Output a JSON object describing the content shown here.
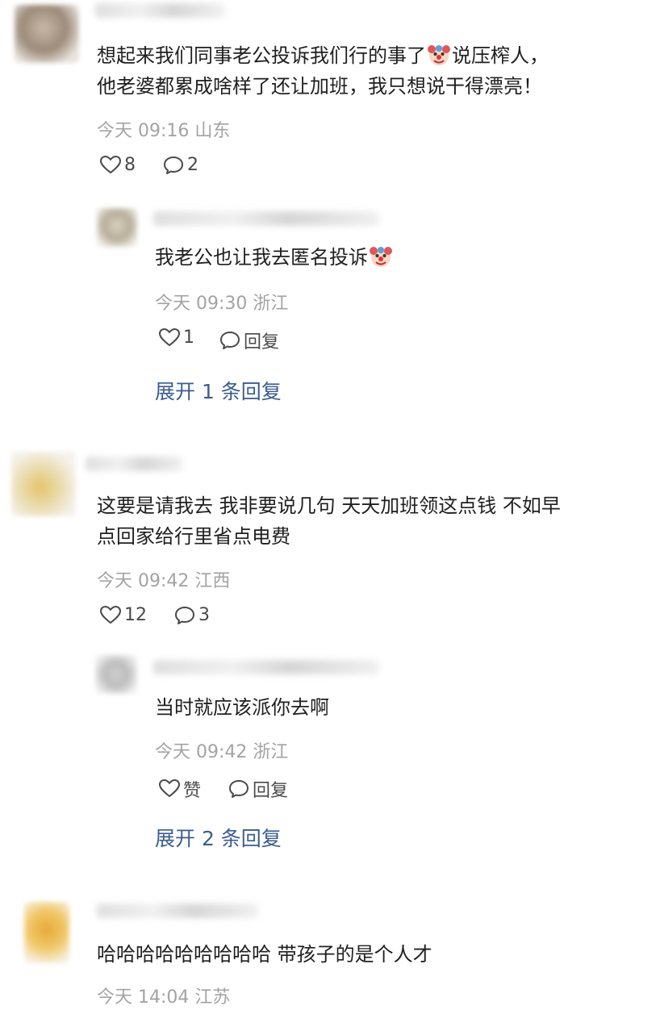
{
  "comments": [
    {
      "text_line1": "想起来我们同事老公投诉我们行的事了",
      "emoji": "clown-face-emoji",
      "text_line1_after": "说压榨人，",
      "text_line2": "他老婆都累成啥样了还让加班，我只想说干得漂亮！",
      "meta": "今天 09:16 山东",
      "likes": "8",
      "replies": "2",
      "reply": {
        "text": "我老公也让我去匿名投诉",
        "emoji": "clown-face-emoji",
        "meta": "今天 09:30 浙江",
        "likes": "1",
        "reply_label": "回复"
      },
      "expand": "展开 1 条回复"
    },
    {
      "text_line1": "这要是请我去 我非要说几句 天天加班领这点钱 不如早",
      "text_line2": "点回家给行里省点电费",
      "meta": "今天 09:42 江西",
      "likes": "12",
      "replies": "3",
      "reply": {
        "text": "当时就应该派你去啊",
        "meta": "今天 09:42 浙江",
        "likes": "赞",
        "reply_label": "回复"
      },
      "expand": "展开 2 条回复"
    },
    {
      "text_line1": "哈哈哈哈哈哈哈哈哈 带孩子的是个人才",
      "meta": "今天 14:04 江苏"
    }
  ],
  "colors": {
    "text": "#1f1f1f",
    "meta": "#a3a3a3",
    "link": "#3b5c8f",
    "icon": "#4a4a4a"
  }
}
